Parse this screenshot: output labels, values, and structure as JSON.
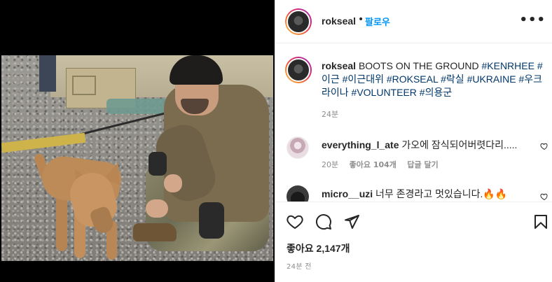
{
  "post": {
    "username": "rokseal",
    "follow_label": "팔로우",
    "more_label": "•••",
    "dot": "•",
    "caption": {
      "username": "rokseal",
      "text": "BOOTS ON THE GROUND",
      "hashtags": "#KENRHEE #이근 #이근대위 #ROKSEAL #락실 #UKRAINE #우크라이나 #VOLUNTEER #의용군",
      "time": "24분"
    },
    "comments": [
      {
        "username": "everything_l_ate",
        "text": "가오에 잠식되어버렷다리.....",
        "time": "20분",
        "likes": "좋아요 104개",
        "reply": "답글 달기"
      },
      {
        "username": "micro__uzi",
        "text": "너무 존경라고 멋있습니다.🔥🔥"
      }
    ],
    "likes_count": "좋아요 2,147개",
    "posted_ago": "24분 전",
    "icons": {
      "like": "heart-icon",
      "comment": "comment-icon",
      "share": "paper-plane-icon",
      "save": "bookmark-icon",
      "more": "more-horizontal-icon"
    }
  }
}
